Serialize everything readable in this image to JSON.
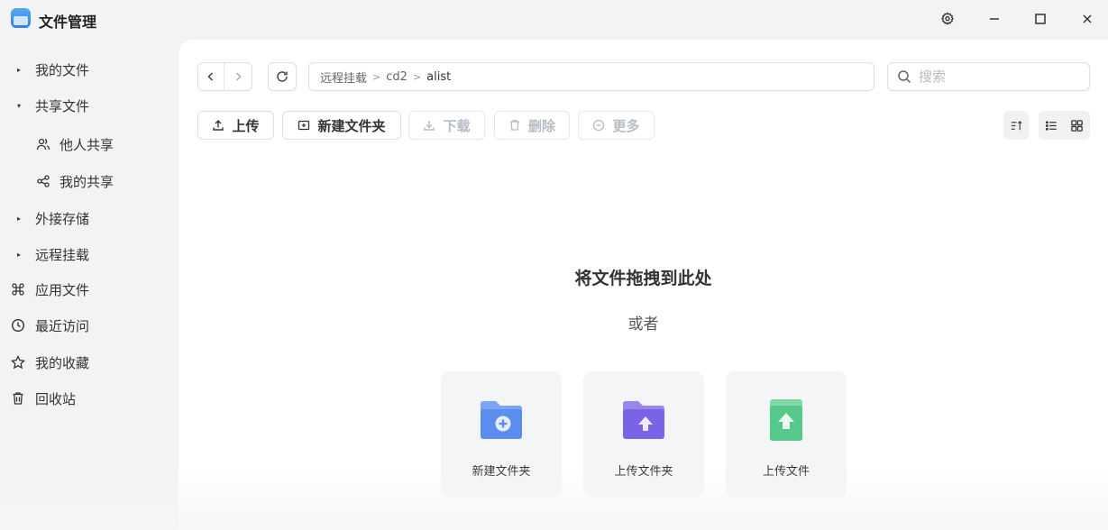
{
  "app": {
    "title": "文件管理"
  },
  "sidebar": {
    "items": [
      {
        "label": "我的文件",
        "icon": "caret-right-icon"
      },
      {
        "label": "共享文件",
        "icon": "caret-down-icon"
      },
      {
        "label": "他人共享",
        "icon": "users-icon"
      },
      {
        "label": "我的共享",
        "icon": "share-icon"
      },
      {
        "label": "外接存储",
        "icon": "caret-right-icon"
      },
      {
        "label": "远程挂载",
        "icon": "caret-right-icon"
      },
      {
        "label": "应用文件",
        "icon": "command-icon"
      },
      {
        "label": "最近访问",
        "icon": "clock-icon"
      },
      {
        "label": "我的收藏",
        "icon": "star-icon"
      },
      {
        "label": "回收站",
        "icon": "trash-icon"
      }
    ]
  },
  "breadcrumb": {
    "items": [
      "远程挂载",
      "cd2",
      "alist"
    ],
    "separator": ">"
  },
  "search": {
    "placeholder": "搜索"
  },
  "toolbar": {
    "upload": "上传",
    "new_folder": "新建文件夹",
    "download": "下载",
    "delete": "删除",
    "more": "更多"
  },
  "empty_state": {
    "title": "将文件拖拽到此处",
    "or": "或者",
    "cards": [
      {
        "label": "新建文件夹",
        "icon": "new-folder-icon",
        "color": "#5b8def"
      },
      {
        "label": "上传文件夹",
        "icon": "upload-folder-icon",
        "color": "#7b63e6"
      },
      {
        "label": "上传文件",
        "icon": "upload-file-icon",
        "color": "#56c98a"
      }
    ]
  }
}
